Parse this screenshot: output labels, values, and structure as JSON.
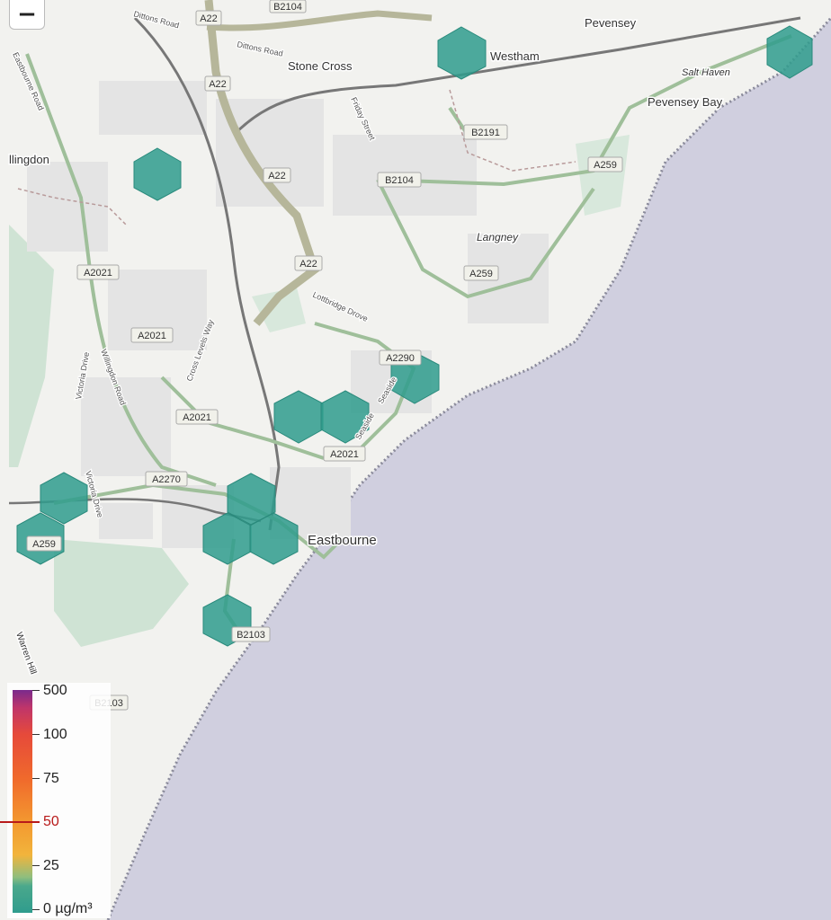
{
  "map": {
    "places": {
      "pevensey": "Pevensey",
      "westham": "Westham",
      "stone_cross": "Stone Cross",
      "salt_haven": "Salt Haven",
      "pevensey_bay": "Pevensey Bay",
      "willingdon": "llingdon",
      "langney": "Langney",
      "eastbourne": "Eastbourne",
      "warren_hill": "Warren Hill"
    },
    "streets": {
      "dittons_road_1": "Dittons Road",
      "dittons_road_2": "Dittons Road",
      "eastbourne_road": "Eastbourne Road",
      "friday_street": "Friday Street",
      "cross_levels_way": "Cross Levels Way",
      "lottbridge_drove": "Lottbridge Drove",
      "victoria_drive_1": "Victoria Drive",
      "victoria_drive_2": "Victoria Drive",
      "willingdon_road": "Willingdon Road",
      "seaside_1": "Seaside",
      "seaside_2": "Seaside"
    },
    "shields": {
      "a22_1": "A22",
      "a22_2": "A22",
      "a22_3": "A22",
      "a22_4": "A22",
      "b2104_top": "B2104",
      "b2104": "B2104",
      "b2191": "B2191",
      "a259_1": "A259",
      "a259_2": "A259",
      "a259_3": "A259",
      "a2021_1": "A2021",
      "a2021_2": "A2021",
      "a2021_3": "A2021",
      "a2021_4": "A2021",
      "a2290": "A2290",
      "a2270": "A2270",
      "b2103_1": "B2103",
      "b2103_2": "B2103"
    },
    "colors": {
      "land": "#f2f2ef",
      "sea": "#d0cfdf",
      "hex": "#2f9c8d",
      "limit": "#b81a1a"
    }
  },
  "controls": {
    "zoom_out": "−"
  },
  "legend": {
    "labels": [
      "500",
      "100",
      "75",
      "50",
      "25",
      "0 µg/m³"
    ],
    "limit_value": 50
  }
}
